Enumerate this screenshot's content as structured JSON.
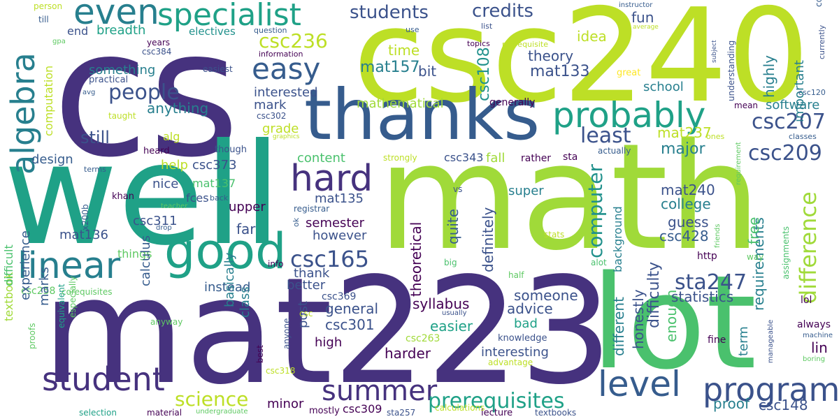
{
  "words": {
    "cs": "cs",
    "csc240": "csc240",
    "math": "math",
    "mat223": "mat223",
    "well": "well",
    "lot": "lot",
    "thanks": "thanks",
    "good": "good",
    "linear": "linear",
    "algebra": "algebra",
    "even": "even",
    "specialist": "specialist",
    "probably": "probably",
    "easy": "easy",
    "hard": "hard",
    "student": "student",
    "summer": "summer",
    "level": "level",
    "program": "program",
    "prerequisites": "prerequisites",
    "people": "people",
    "csc236": "csc236",
    "csc165": "csc165",
    "csc207": "csc207",
    "csc209": "csc209",
    "students": "students",
    "credits": "credits",
    "science": "science",
    "difference": "difference",
    "least": "least",
    "computer": "computer",
    "sta247": "sta247",
    "theory": "theory",
    "mat157": "mat157",
    "csc108": "csc108",
    "mat133": "mat133",
    "time": "time",
    "idea": "idea",
    "fun": "fun",
    "breadth": "breadth",
    "electives": "electives",
    "end": "end",
    "something": "something",
    "bit": "bit",
    "interested": "interested",
    "mark": "mark",
    "anything": "anything",
    "computation": "computation",
    "still": "still",
    "design": "design",
    "help": "help",
    "csc373": "csc373",
    "nice": "nice",
    "mat137": "mat137",
    "fces": "fces",
    "csc311": "csc311",
    "mat135": "mat135",
    "upper": "upper",
    "far": "far",
    "semester": "semester",
    "however": "however",
    "mat136": "mat136",
    "things": "things",
    "thank": "thank",
    "better": "better",
    "instead": "instead",
    "calculus": "calculus",
    "csc258": "csc258",
    "corequisites": "corequisites",
    "experience": "experience",
    "marks": "marks",
    "textbook": "textbook",
    "difficult": "difficult",
    "equivalent": "equivalent",
    "proofs": "proofs",
    "especially": "especially",
    "basically": "basically",
    "class": "class",
    "general": "general",
    "csc301": "csc301",
    "csc369": "csc369",
    "high": "high",
    "post": "post",
    "harder": "harder",
    "syllabus": "syllabus",
    "someone": "someone",
    "advice": "advice",
    "easier": "easier",
    "interesting": "interesting",
    "bad": "bad",
    "csc263": "csc263",
    "knowledge": "knowledge",
    "advantage": "advantage",
    "minor": "minor",
    "mostly": "mostly",
    "csc309": "csc309",
    "sta257": "sta257",
    "lecture": "lecture",
    "textbooks": "textbooks",
    "material": "material",
    "undergraduate": "undergraduate",
    "selection": "selection",
    "csc318": "csc318",
    "best": "best",
    "anyone": "anyone",
    "csc": "csc",
    "usually": "usually",
    "anyway": "anyway",
    "calculations": "calculations",
    "theoretical": "theoretical",
    "quite": "quite",
    "definitely": "definitely",
    "different": "different",
    "honestly": "honestly",
    "difficulty": "difficulty",
    "enough": "enough",
    "term": "term",
    "requirements": "requirements",
    "free": "free",
    "csc428": "csc428",
    "guess": "guess",
    "college": "college",
    "mat240": "mat240",
    "major": "major",
    "mat237": "mat237",
    "software": "software",
    "school": "school",
    "important": "important",
    "highly": "highly",
    "mathematical": "mathematical",
    "generally": "generally",
    "content": "content",
    "grade": "grade",
    "alg": "alg",
    "csc343": "csc343",
    "strongly": "strongly",
    "fall": "fall",
    "rather": "rather",
    "sta": "sta",
    "actually": "actually",
    "super": "super",
    "background": "background",
    "statistics": "statistics",
    "lin": "lin",
    "proof": "proof",
    "csc148": "csc148",
    "fine": "fine",
    "always": "always",
    "lol": "lol",
    "machine": "machine",
    "boring": "boring",
    "manageable": "manageable",
    "assignments": "assignments",
    "friends": "friends",
    "http": "http",
    "way": "way",
    "alot": "alot",
    "stats": "stats",
    "half": "half",
    "big": "big",
    "info": "info",
    "vs": "vs",
    "ok": "ok",
    "registrar": "registrar",
    "back": "back",
    "khan": "khan",
    "teacher": "teacher",
    "drop": "drop",
    "x200b": "x200b",
    "terms": "terms",
    "heard": "heard",
    "though": "though",
    "taught": "taught",
    "graphics": "graphics",
    "csc302": "csc302",
    "avg": "avg",
    "practical": "practical",
    "easiest": "easiest",
    "information": "information",
    "csc384": "csc384",
    "years": "years",
    "gpa": "gpa",
    "till": "till",
    "person": "person",
    "question": "question",
    "use": "use",
    "list": "list",
    "topics": "topics",
    "prerequisite": "prerequisite",
    "instructor": "instructor",
    "average": "average",
    "subject": "subject",
    "currently": "currently",
    "understanding": "understanding",
    "great": "great",
    "mean": "mean",
    "csc120": "csc120",
    "ones": "ones",
    "classes": "classes",
    "requirement": "requirement",
    "course": "course"
  }
}
